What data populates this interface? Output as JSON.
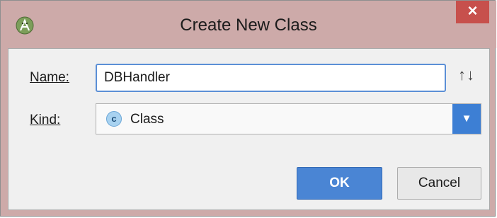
{
  "window": {
    "title": "Create New Class",
    "close_label": "×",
    "app_icon": "android-studio-icon"
  },
  "form": {
    "name_label": "Name:",
    "name_value": "DBHandler",
    "sort_icon": "↑↓",
    "kind_label": "Kind:",
    "kind_icon_letter": "c",
    "kind_value": "Class",
    "dropdown_arrow": "▼"
  },
  "buttons": {
    "ok_label": "OK",
    "cancel_label": "Cancel"
  },
  "colors": {
    "titlebar": "#cdaaa9",
    "close_button": "#c7504c",
    "accent": "#4a85d4",
    "dropdown": "#3d7fd4"
  }
}
